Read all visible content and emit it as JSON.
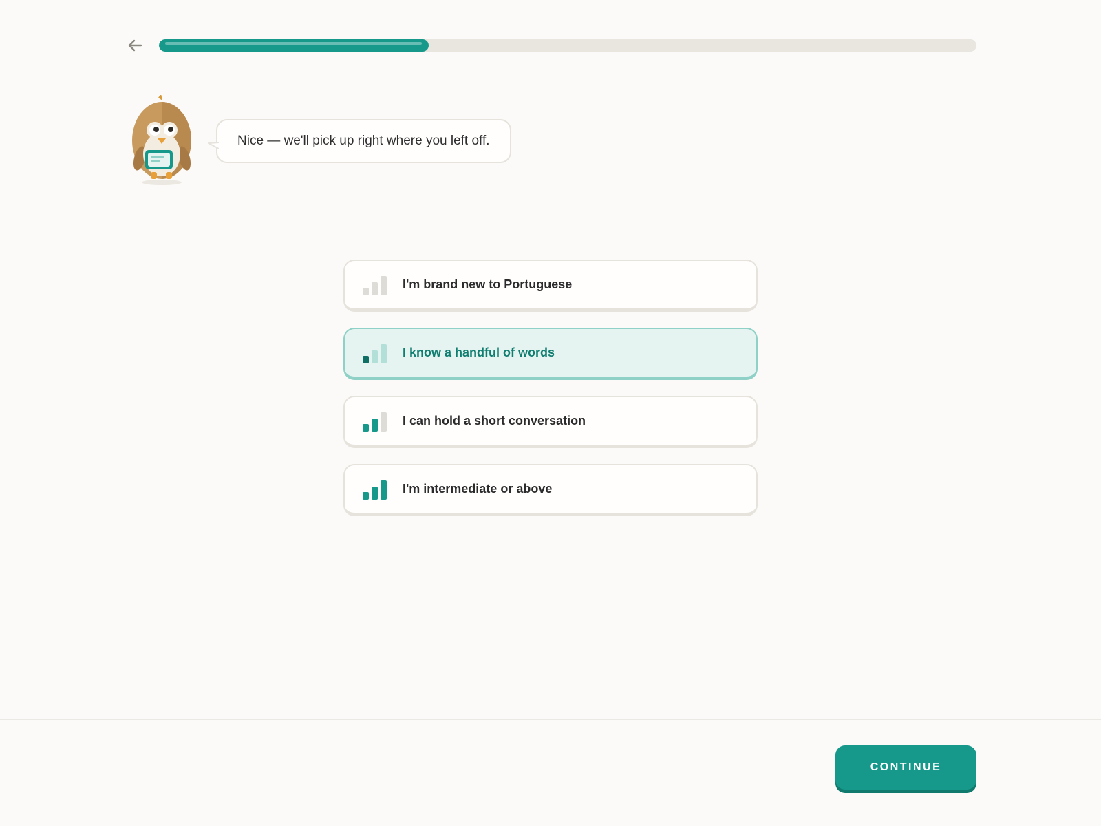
{
  "header": {
    "back_icon": "arrow-left-icon",
    "progress_fraction": 0.33
  },
  "mascot": {
    "icon": "owl-mascot-icon"
  },
  "speech": {
    "text": "Nice — we'll pick up right where you left off."
  },
  "options": [
    {
      "label": "I'm brand new to Portuguese",
      "level": 0,
      "selected": false,
      "icon": "signal-bars-icon"
    },
    {
      "label": "I know a handful of words",
      "level": 1,
      "selected": true,
      "icon": "signal-bars-icon"
    },
    {
      "label": "I can hold a short conversation",
      "level": 2,
      "selected": false,
      "icon": "signal-bars-icon"
    },
    {
      "label": "I'm intermediate or above",
      "level": 3,
      "selected": false,
      "icon": "signal-bars-icon"
    }
  ],
  "footer": {
    "continue_label": "CONTINUE"
  },
  "colors": {
    "accent": "#16998a",
    "accent_dark": "#0f7a6d",
    "selected_bg": "#e6f4f1",
    "selected_border": "#8fd1c6",
    "bar_inactive": "#dedcd6"
  }
}
